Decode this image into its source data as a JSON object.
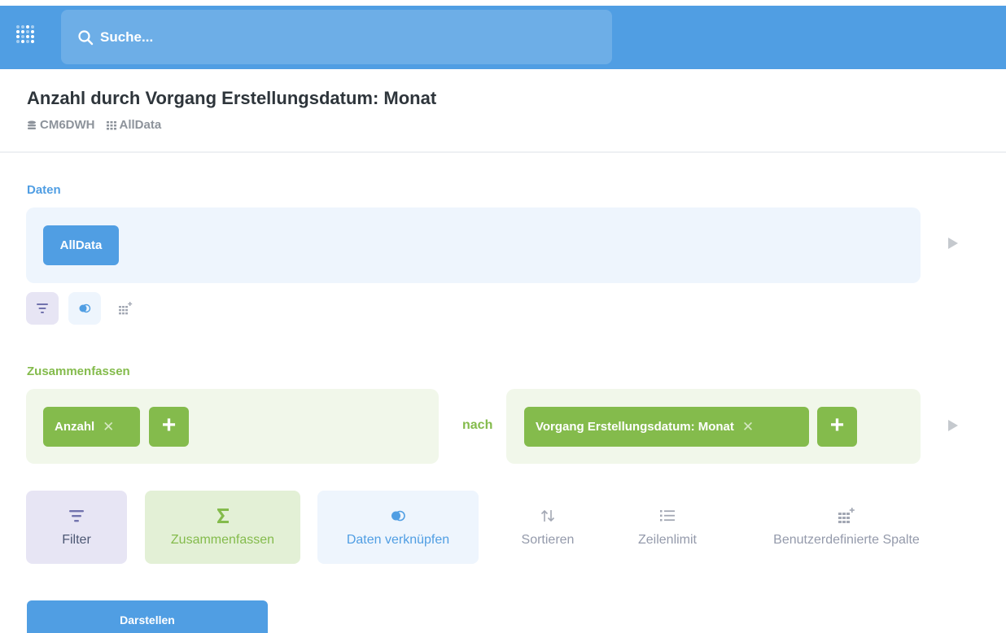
{
  "search": {
    "placeholder": "Suche..."
  },
  "header": {
    "title": "Anzahl durch Vorgang Erstellungsdatum: Monat",
    "database": "CM6DWH",
    "table": "AllData"
  },
  "data_section": {
    "label": "Daten",
    "source_table": "AllData"
  },
  "summarize_section": {
    "label": "Zusammenfassen",
    "metric": "Anzahl",
    "by_label": "nach",
    "breakout": "Vorgang Erstellungsdatum: Monat"
  },
  "actions": {
    "filter": "Filter",
    "summarize": "Zusammenfassen",
    "join": "Daten verknüpfen",
    "sort": "Sortieren",
    "limit": "Zeilenlimit",
    "custom_column": "Benutzerdefinierte Spalte"
  },
  "visualize_button": "Darstellen",
  "colors": {
    "brand": "#509ee3",
    "summarize": "#84bb4c",
    "filter": "#7172ad",
    "muted": "#949aab"
  }
}
